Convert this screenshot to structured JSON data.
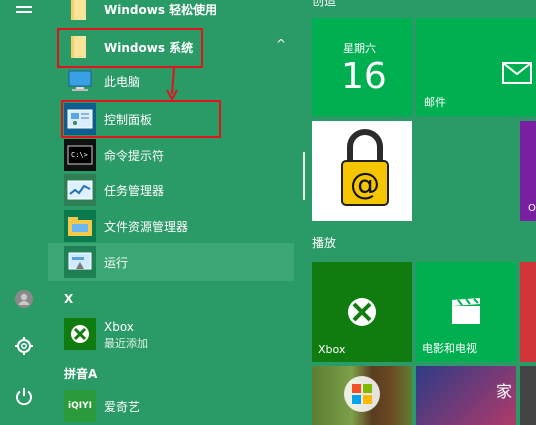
{
  "left_rail": {
    "icons": [
      "menu-icon",
      "user-icon",
      "settings-icon",
      "power-icon"
    ]
  },
  "apps": {
    "items": [
      {
        "label": "Windows 轻松使用",
        "icon": "folder-icon"
      },
      {
        "label": "Windows 系统",
        "icon": "folder-icon",
        "expanded_glyph": "^"
      },
      {
        "label": "此电脑",
        "icon": "computer-icon"
      },
      {
        "label": "控制面板",
        "icon": "control-panel-icon"
      },
      {
        "label": "命令提示符",
        "icon": "cmd-icon"
      },
      {
        "label": "任务管理器",
        "icon": "task-manager-icon"
      },
      {
        "label": "文件资源管理器",
        "icon": "file-explorer-icon"
      },
      {
        "label": "运行",
        "icon": "run-icon"
      }
    ],
    "sections": [
      {
        "header": "X"
      },
      {
        "header": "拼音A"
      }
    ],
    "xbox": {
      "label": "Xbox",
      "sub": "最近添加"
    },
    "iqiyi": {
      "label": "爱奇艺",
      "icon_text": "iQIYI"
    }
  },
  "tiles": {
    "group_top_partial": "创造",
    "calendar": {
      "weekday": "星期六",
      "day": "16"
    },
    "mail": {
      "label": "邮件"
    },
    "group_play": "播放",
    "xbox_tile": {
      "label": "Xbox"
    },
    "movies": {
      "label": "电影和电视"
    },
    "partial_letter": "O"
  },
  "watermark": {
    "text": "家"
  },
  "colors": {
    "start_bg": "#2a9a66",
    "tile_green": "#00b050",
    "tile_dark_green": "#107c10",
    "highlight_red": "#e1141b"
  }
}
